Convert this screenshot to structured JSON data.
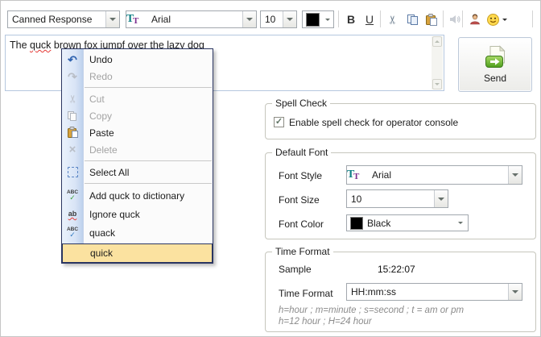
{
  "toolbar": {
    "canned_response_value": "Canned Response",
    "font_family_value": "Arial",
    "font_size_value": "10",
    "font_color_hex": "#000000",
    "bold_label": "B",
    "underline_label": "U",
    "icon_names": [
      "cut-icon",
      "copy-icon",
      "paste-icon",
      "sound-icon",
      "operator-icon",
      "emoticon-icon"
    ]
  },
  "icons": {
    "undo_glyph": "↶",
    "redo_glyph": "↷",
    "cut_glyph": "✂",
    "delete_glyph": "×",
    "check_glyph": "✓",
    "abc_label": "ABC",
    "ab_label": "ab",
    "ttf_t1": "T",
    "ttf_t2": "T"
  },
  "editor": {
    "text_before": "The ",
    "misspelled_word": "quck",
    "text_after": " brown fox jumpf over the lazy dog",
    "send_label": "Send"
  },
  "context_menu": {
    "items": [
      {
        "label": "Undo",
        "state": "enabled",
        "icon": "undo-icon"
      },
      {
        "label": "Redo",
        "state": "disabled",
        "icon": "redo-icon"
      },
      {
        "label": "Cut",
        "state": "disabled",
        "icon": "cut-icon"
      },
      {
        "label": "Copy",
        "state": "disabled",
        "icon": "copy-icon"
      },
      {
        "label": "Paste",
        "state": "enabled",
        "icon": "paste-icon"
      },
      {
        "label": "Delete",
        "state": "disabled",
        "icon": "delete-icon"
      },
      {
        "label": "Select All",
        "state": "enabled",
        "icon": "select-all-icon"
      },
      {
        "label": "Add quck to dictionary",
        "state": "enabled",
        "icon": "add-to-dictionary-icon"
      },
      {
        "label": "Ignore quck",
        "state": "enabled",
        "icon": "ignore-word-icon"
      },
      {
        "label": "quack",
        "state": "enabled",
        "icon": "suggestion-check-icon"
      },
      {
        "label": "quick",
        "state": "highlighted",
        "icon": ""
      }
    ]
  },
  "spell_check": {
    "title": "Spell Check",
    "checkbox_label": "Enable spell check for operator console",
    "checked": true
  },
  "default_font": {
    "title": "Default Font",
    "font_style_label": "Font Style",
    "font_style_value": "Arial",
    "font_size_label": "Font Size",
    "font_size_value": "10",
    "font_color_label": "Font Color",
    "font_color_value": "Black",
    "font_color_hex": "#000000"
  },
  "time_format": {
    "title": "Time Format",
    "sample_label": "Sample",
    "sample_value": "15:22:07",
    "format_label": "Time Format",
    "format_value": "HH:mm:ss",
    "note_line1": "h=hour ; m=minute ; s=second ; t = am or pm",
    "note_line2": "h=12 hour ; H=24 hour"
  },
  "colors": {
    "send_green": "#57A820",
    "menu_highlight_bg": "#FBE2A0",
    "menu_border": "#2A3561",
    "squiggle_red": "#E53935"
  }
}
